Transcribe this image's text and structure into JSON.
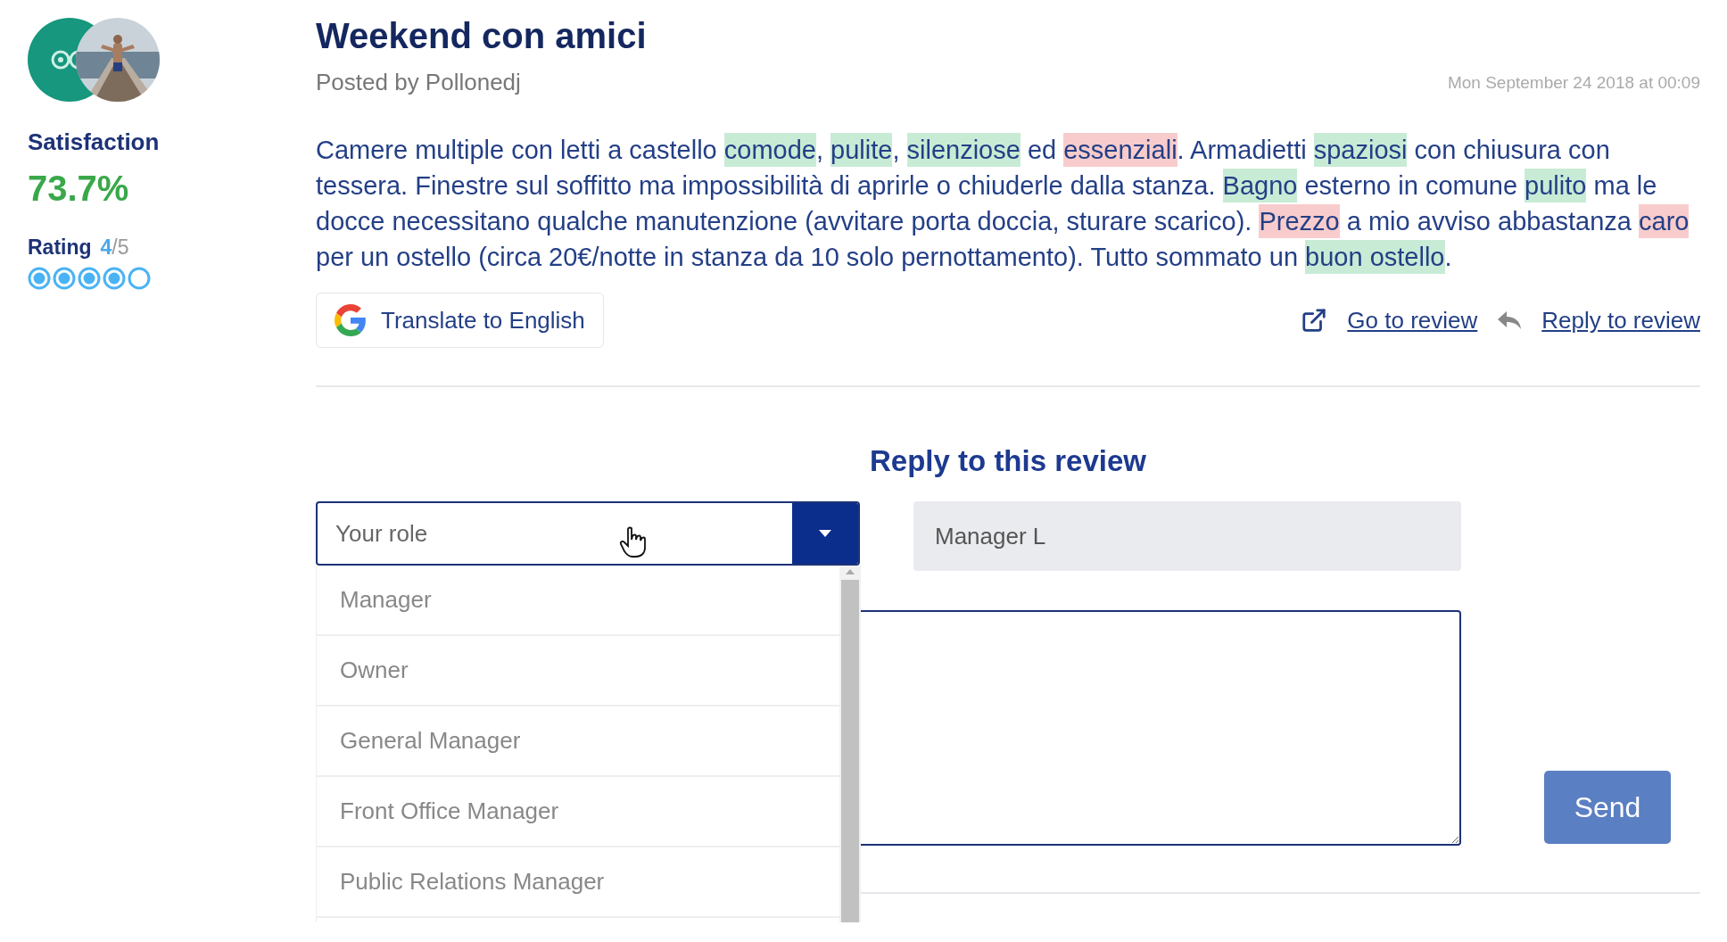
{
  "sidebar": {
    "satisfaction_label": "Satisfaction",
    "satisfaction_value": "73.7%",
    "rating_label": "Rating",
    "rating_value": "4",
    "rating_max": "/5",
    "stars": 4
  },
  "review": {
    "title": "Weekend con amici",
    "author": "Posted by Pollonedj",
    "date": "Mon September 24 2018 at 00:09",
    "segments": [
      {
        "text": "Camere multiple con letti a castello "
      },
      {
        "text": "comode",
        "color": "#c8ebd5"
      },
      {
        "text": ", "
      },
      {
        "text": "pulite",
        "color": "#c8ebd5"
      },
      {
        "text": ", "
      },
      {
        "text": "silenziose",
        "color": "#c8ebd5"
      },
      {
        "text": " ed "
      },
      {
        "text": "essenziali",
        "color": "#f8cccc"
      },
      {
        "text": ". Armadietti "
      },
      {
        "text": "spaziosi",
        "color": "#c8ebd5"
      },
      {
        "text": " con chiusura con tessera. Finestre sul soffitto ma impossibilità di aprirle o chiuderle dalla stanza. "
      },
      {
        "text": "Bagno",
        "color": "#c8ebd5"
      },
      {
        "text": " esterno in comune "
      },
      {
        "text": "pulito",
        "color": "#c8ebd5"
      },
      {
        "text": " ma le docce necessitano qualche manutenzione (avvitare porta doccia, sturare scarico). "
      },
      {
        "text": "Prezzo",
        "color": "#f8cccc"
      },
      {
        "text": " a mio avviso abbastanza "
      },
      {
        "text": "caro",
        "color": "#f8cccc"
      },
      {
        "text": " per un ostello (circa 20€/notte in stanza da 10 solo pernottamento). Tutto sommato un "
      },
      {
        "text": "buon",
        "color": "#c8ebd5"
      },
      {
        "text": " ostello",
        "color": "#c8ebd5"
      },
      {
        "text": "."
      }
    ],
    "translate_button": "Translate to English",
    "links": [
      {
        "kind": "external",
        "label": "Go to review"
      },
      {
        "kind": "reply",
        "label": "Reply to review"
      }
    ]
  },
  "reply_form": {
    "heading": "Reply to this review",
    "role_select": {
      "placeholder": "Your role",
      "expanded": true,
      "options": [
        "Manager",
        "Owner",
        "General Manager",
        "Front Office Manager",
        "Public Relations Manager"
      ]
    },
    "name_field": {
      "value": "Manager L"
    },
    "send_button": "Send"
  }
}
